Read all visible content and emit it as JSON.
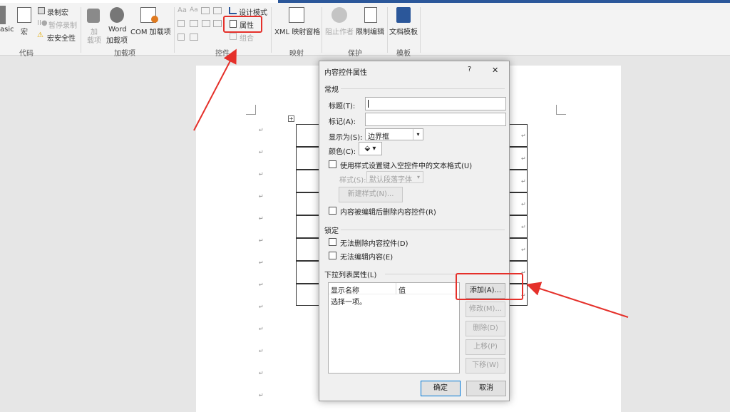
{
  "ribbon": {
    "code": {
      "basic_label": "asic",
      "macro_label": "宏",
      "record_macro": "录制宏",
      "pause_record": "暂停录制",
      "macro_security": "宏安全性",
      "group": "代码"
    },
    "addins": {
      "addin_label_1": "加",
      "addin_label_2": "载项",
      "word_label_1": "Word",
      "word_label_2": "加载项",
      "com_label": "COM 加载项",
      "group": "加载项"
    },
    "controls": {
      "design_mode": "设计模式",
      "properties": "属性",
      "group_cmd": "组合",
      "group": "控件",
      "aa1": "Aa",
      "aa2": "Aa"
    },
    "mapping": {
      "xml_label": "XML 映射窗格",
      "group": "映射"
    },
    "protect": {
      "block_authors": "阻止作者",
      "restrict_edit": "限制编辑",
      "group": "保护"
    },
    "templates": {
      "doc_template": "文档模板",
      "group": "模板"
    }
  },
  "dialog": {
    "title": "内容控件属性",
    "help": "?",
    "close": "✕",
    "general": "常规",
    "title_field": {
      "label": "标题(T):",
      "value": ""
    },
    "tag_field": {
      "label": "标记(A):",
      "value": ""
    },
    "show_as": {
      "label": "显示为(S):",
      "value": "边界框"
    },
    "color": {
      "label": "颜色(C):"
    },
    "use_style": "使用样式设置键入空控件中的文本格式(U)",
    "style": {
      "label": "样式(S):",
      "value": "默认段落字体"
    },
    "new_style": "新建样式(N)...",
    "remove_after_edit": "内容被编辑后删除内容控件(R)",
    "locking": "锁定",
    "cannot_delete": "无法删除内容控件(D)",
    "cannot_edit": "无法编辑内容(E)",
    "dropdown_props": "下拉列表属性(L)",
    "col_display": "显示名称",
    "col_value": "值",
    "item_text": "选择一项。",
    "add": "添加(A)...",
    "modify": "修改(M)...",
    "delete": "删除(D)",
    "move_up": "上移(P)",
    "move_down": "下移(W)",
    "ok": "确定",
    "cancel": "取消"
  },
  "doc": {
    "para_mark": "↵",
    "table_move": "+"
  }
}
